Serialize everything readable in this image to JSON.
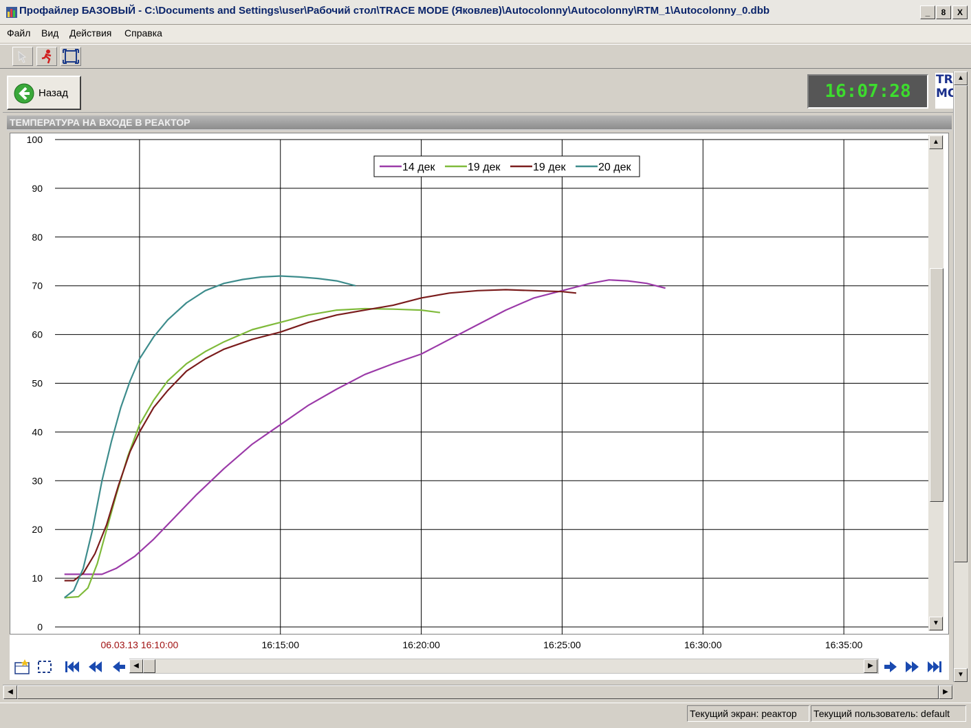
{
  "window": {
    "title": "Профайлер БАЗОВЫЙ - C:\\Documents and Settings\\user\\Рабочий стол\\TRACE MODE (Яковлев)\\Autocolonny\\Autocolonny\\RTM_1\\Autocolonny_0.dbb",
    "buttons": [
      "_",
      "8",
      "X"
    ]
  },
  "menu": [
    "Файл",
    "Вид",
    "Действия",
    "Справка"
  ],
  "toolbar": {
    "icons": [
      "disabled-cursor-icon",
      "running-man-icon",
      "fit-frame-icon"
    ]
  },
  "header": {
    "back_label": "Назад",
    "clock": "16:07:28",
    "logo_text": "TRA MO"
  },
  "graph": {
    "title": "ТЕМПЕРАТУРА НА ВХОДЕ В РЕАКТОР",
    "start_label": "06.03.13 16:10:00"
  },
  "chart_data": {
    "type": "line",
    "title": "ТЕМПЕРАТУРА НА ВХОДЕ В РЕАКТОР",
    "x_unit": "minutes",
    "ylim": [
      0,
      100
    ],
    "xlim": [
      "16:07:00",
      "16:38:00"
    ],
    "y_ticks": [
      0,
      10,
      20,
      30,
      40,
      50,
      60,
      70,
      80,
      90,
      100
    ],
    "x_ticks": [
      "16:10:00",
      "16:15:00",
      "16:20:00",
      "16:25:00",
      "16:30:00",
      "16:35:00"
    ],
    "grid": true,
    "legend_position": "top-center",
    "series": [
      {
        "name": "14 дек",
        "color": "#9b3aa8",
        "x": [
          "16:07:20",
          "16:08:00",
          "16:08:40",
          "16:09:10",
          "16:09:50",
          "16:10:30",
          "16:11:15",
          "16:12:00",
          "16:13:00",
          "16:14:00",
          "16:15:00",
          "16:16:00",
          "16:17:00",
          "16:18:00",
          "16:19:00",
          "16:20:00",
          "16:21:00",
          "16:22:00",
          "16:23:00",
          "16:24:00",
          "16:25:00",
          "16:26:00",
          "16:26:40",
          "16:27:20",
          "16:28:00",
          "16:28:40"
        ],
        "y": [
          10.8,
          10.8,
          10.8,
          12.0,
          14.5,
          18.0,
          22.5,
          27.0,
          32.5,
          37.5,
          41.5,
          45.5,
          48.8,
          51.8,
          54.0,
          56.0,
          59.0,
          62.0,
          65.0,
          67.5,
          69.0,
          70.5,
          71.2,
          71.0,
          70.5,
          69.5
        ]
      },
      {
        "name": "19 дек",
        "color": "#7fba3a",
        "x": [
          "16:07:20",
          "16:07:50",
          "16:08:10",
          "16:08:30",
          "16:08:50",
          "16:09:10",
          "16:09:35",
          "16:10:00",
          "16:10:30",
          "16:11:00",
          "16:11:40",
          "16:12:20",
          "16:13:00",
          "16:14:00",
          "16:15:00",
          "16:16:00",
          "16:17:00",
          "16:18:00",
          "16:19:00",
          "16:20:00",
          "16:20:40"
        ],
        "y": [
          6.0,
          6.2,
          8.0,
          13.0,
          20.0,
          27.0,
          35.0,
          41.5,
          46.5,
          50.5,
          54.0,
          56.5,
          58.5,
          61.0,
          62.5,
          64.0,
          65.0,
          65.3,
          65.2,
          65.0,
          64.5
        ]
      },
      {
        "name": "19 дек",
        "color": "#7a1c1c",
        "x": [
          "16:07:20",
          "16:07:40",
          "16:08:00",
          "16:08:25",
          "16:08:50",
          "16:09:15",
          "16:09:40",
          "16:10:00",
          "16:10:30",
          "16:11:00",
          "16:11:40",
          "16:12:20",
          "16:13:00",
          "16:14:00",
          "16:15:00",
          "16:16:00",
          "16:17:00",
          "16:18:00",
          "16:19:00",
          "16:20:00",
          "16:21:00",
          "16:22:00",
          "16:23:00",
          "16:24:00",
          "16:25:00",
          "16:25:30"
        ],
        "y": [
          9.5,
          9.5,
          11.0,
          15.0,
          21.0,
          29.0,
          36.0,
          40.0,
          45.0,
          48.5,
          52.5,
          55.0,
          57.0,
          59.0,
          60.5,
          62.5,
          64.0,
          65.0,
          66.0,
          67.5,
          68.5,
          69.0,
          69.2,
          69.0,
          68.8,
          68.5
        ]
      },
      {
        "name": "20 дек",
        "color": "#3d8c8c",
        "x": [
          "16:07:20",
          "16:07:40",
          "16:08:00",
          "16:08:20",
          "16:08:40",
          "16:09:00",
          "16:09:20",
          "16:09:40",
          "16:10:00",
          "16:10:30",
          "16:11:00",
          "16:11:40",
          "16:12:20",
          "16:13:00",
          "16:13:40",
          "16:14:20",
          "16:15:00",
          "16:15:40",
          "16:16:20",
          "16:17:00",
          "16:17:40"
        ],
        "y": [
          6.0,
          7.5,
          12.0,
          20.0,
          30.0,
          38.0,
          45.0,
          50.5,
          55.0,
          59.5,
          63.0,
          66.5,
          69.0,
          70.5,
          71.3,
          71.8,
          72.0,
          71.8,
          71.5,
          71.0,
          70.0
        ]
      }
    ]
  },
  "nav": {
    "icons": [
      "add-chart-icon",
      "select-area-icon",
      "go-first-icon",
      "fast-back-icon",
      "step-back-icon",
      "step-forward-icon",
      "fast-forward-icon",
      "go-last-icon"
    ]
  },
  "status": {
    "screen": "Текущий экран: реактор",
    "user": "Текущий пользователь: default"
  }
}
